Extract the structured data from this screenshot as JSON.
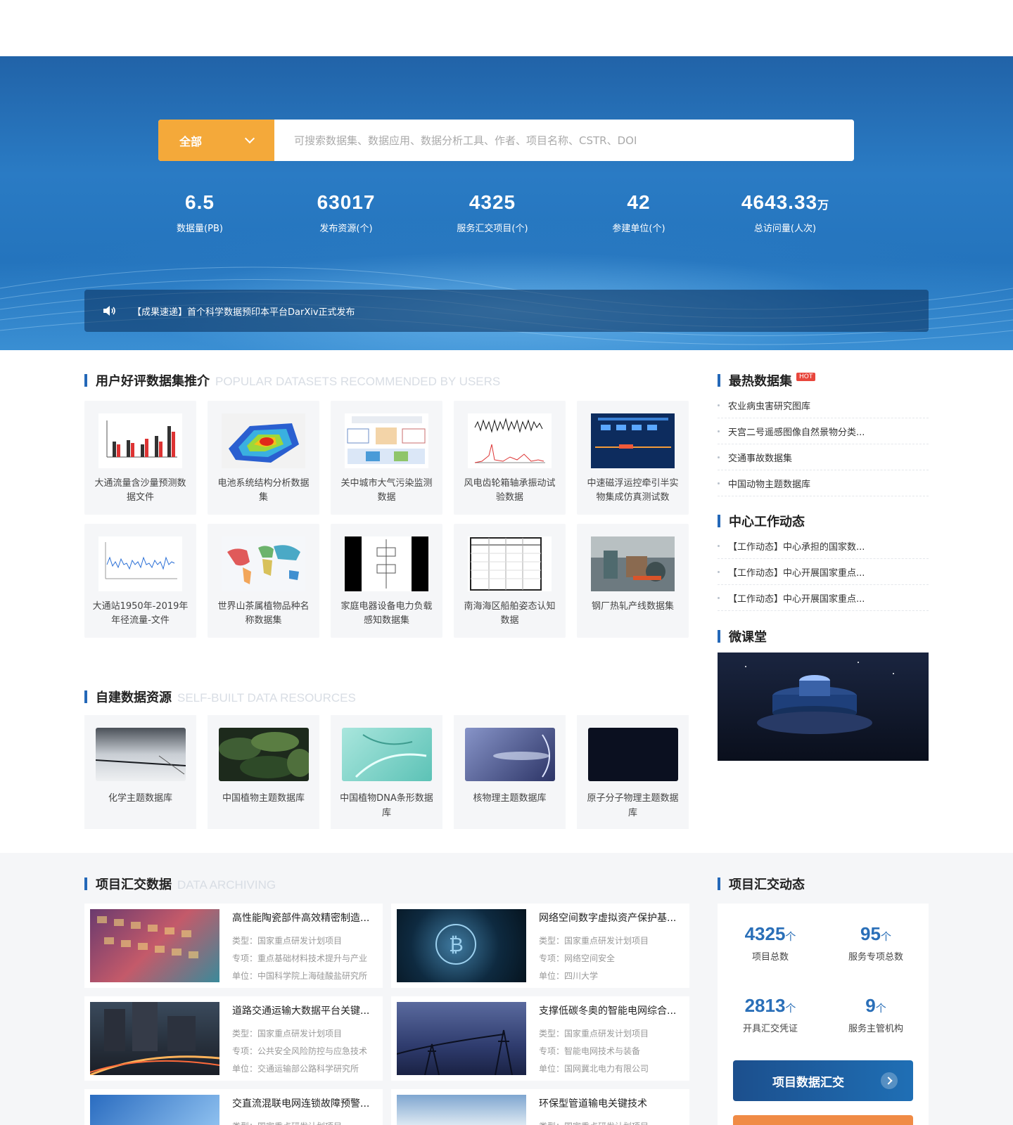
{
  "search": {
    "category": "全部",
    "placeholder": "可搜索数据集、数据应用、数据分析工具、作者、项目名称、CSTR、DOI"
  },
  "stats": [
    {
      "value": "6.5",
      "unit": "",
      "label": "数据量(PB)"
    },
    {
      "value": "63017",
      "unit": "",
      "label": "发布资源(个)"
    },
    {
      "value": "4325",
      "unit": "",
      "label": "服务汇交项目(个)"
    },
    {
      "value": "42",
      "unit": "",
      "label": "参建单位(个)"
    },
    {
      "value": "4643.33",
      "unit": "万",
      "label": "总访问量(人次)"
    }
  ],
  "notice": {
    "icon": "speaker-icon",
    "text": "【成果速递】首个科学数据预印本平台DarXiv正式发布"
  },
  "popular": {
    "title": "用户好评数据集推介",
    "title_en": "POPULAR DATASETS RECOMMENDED BY USERS",
    "items": [
      {
        "label": "大通流量含沙量预测数据文件"
      },
      {
        "label": "电池系统结构分析数据集"
      },
      {
        "label": "关中城市大气污染监测数据"
      },
      {
        "label": "风电齿轮箱轴承振动试验数据"
      },
      {
        "label": "中速磁浮运控牵引半实物集成仿真测试数"
      },
      {
        "label": "大通站1950年-2019年年径流量-文件"
      },
      {
        "label": "世界山茶属植物品种名称数据集"
      },
      {
        "label": "家庭电器设备电力负载感知数据集"
      },
      {
        "label": "南海海区船舶姿态认知数据"
      },
      {
        "label": "钢厂热轧产线数据集"
      }
    ]
  },
  "hot": {
    "title": "最热数据集",
    "badge": "HOT",
    "items": [
      "农业病虫害研究图库",
      "天宫二号遥感图像自然景物分类...",
      "交通事故数据集",
      "中国动物主题数据库"
    ]
  },
  "news": {
    "title": "中心工作动态",
    "items": [
      "【工作动态】中心承担的国家数...",
      "【工作动态】中心开展国家重点...",
      "【工作动态】中心开展国家重点..."
    ]
  },
  "course": {
    "title": "微课堂"
  },
  "resources": {
    "title": "自建数据资源",
    "title_en": "SELF-BUILT DATA RESOURCES",
    "items": [
      {
        "label": "化学主题数据库"
      },
      {
        "label": "中国植物主题数据库"
      },
      {
        "label": "中国植物DNA条形数据库"
      },
      {
        "label": "核物理主题数据库"
      },
      {
        "label": "原子分子物理主题数据库"
      }
    ]
  },
  "projects": {
    "title": "项目汇交数据",
    "title_en": "DATA ARCHIVING",
    "items": [
      {
        "title": "高性能陶瓷部件高效精密制造...",
        "type": "类型：国家重点研发计划项目",
        "special": "专项：重点基础材料技术提升与产业",
        "unit": "单位：中国科学院上海硅酸盐研究所"
      },
      {
        "title": "网络空间数字虚拟资产保护基...",
        "type": "类型：国家重点研发计划项目",
        "special": "专项：网络空间安全",
        "unit": "单位：四川大学"
      },
      {
        "title": "道路交通运输大数据平台关键...",
        "type": "类型：国家重点研发计划项目",
        "special": "专项：公共安全风险防控与应急技术",
        "unit": "单位：交通运输部公路科学研究所"
      },
      {
        "title": "支撑低碳冬奥的智能电网综合...",
        "type": "类型：国家重点研发计划项目",
        "special": "专项：智能电网技术与装备",
        "unit": "单位：国网冀北电力有限公司"
      },
      {
        "title": "交直流混联电网连锁故障预警...",
        "type": "类型：国家重点研发计划项目",
        "special": "",
        "unit": ""
      },
      {
        "title": "环保型管道输电关键技术",
        "type": "类型：国家重点研发计划项目",
        "special": "",
        "unit": ""
      }
    ]
  },
  "summary": {
    "title": "项目汇交动态",
    "items": [
      {
        "value": "4325",
        "unit": "个",
        "label": "项目总数"
      },
      {
        "value": "95",
        "unit": "个",
        "label": "服务专项总数"
      },
      {
        "value": "2813",
        "unit": "个",
        "label": "开具汇交凭证"
      },
      {
        "value": "9",
        "unit": "个",
        "label": "服务主管机构"
      }
    ],
    "button": "项目数据汇交"
  }
}
